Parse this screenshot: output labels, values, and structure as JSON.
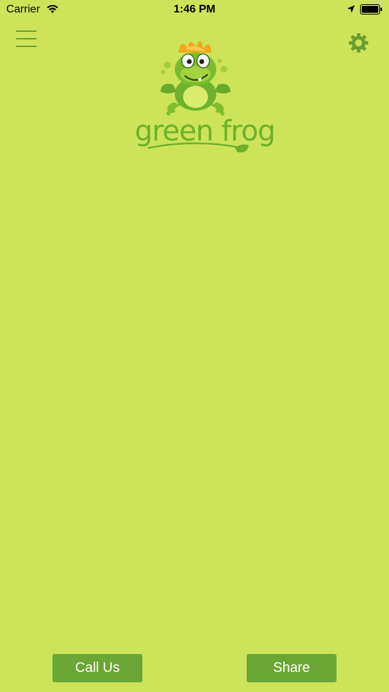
{
  "status_bar": {
    "carrier": "Carrier",
    "time": "1:46 PM"
  },
  "icons": {
    "menu": "hamburger-menu-icon",
    "settings": "gear-icon",
    "wifi": "wifi-icon",
    "location": "location-arrow-icon",
    "battery": "battery-icon"
  },
  "logo": {
    "text": "green frog"
  },
  "actions": {
    "call_label": "Call Us",
    "share_label": "Share"
  },
  "colors": {
    "background": "#cde35a",
    "accent": "#6aa636",
    "icon": "#6a9e2c",
    "logo_text": "#6fb02a"
  }
}
